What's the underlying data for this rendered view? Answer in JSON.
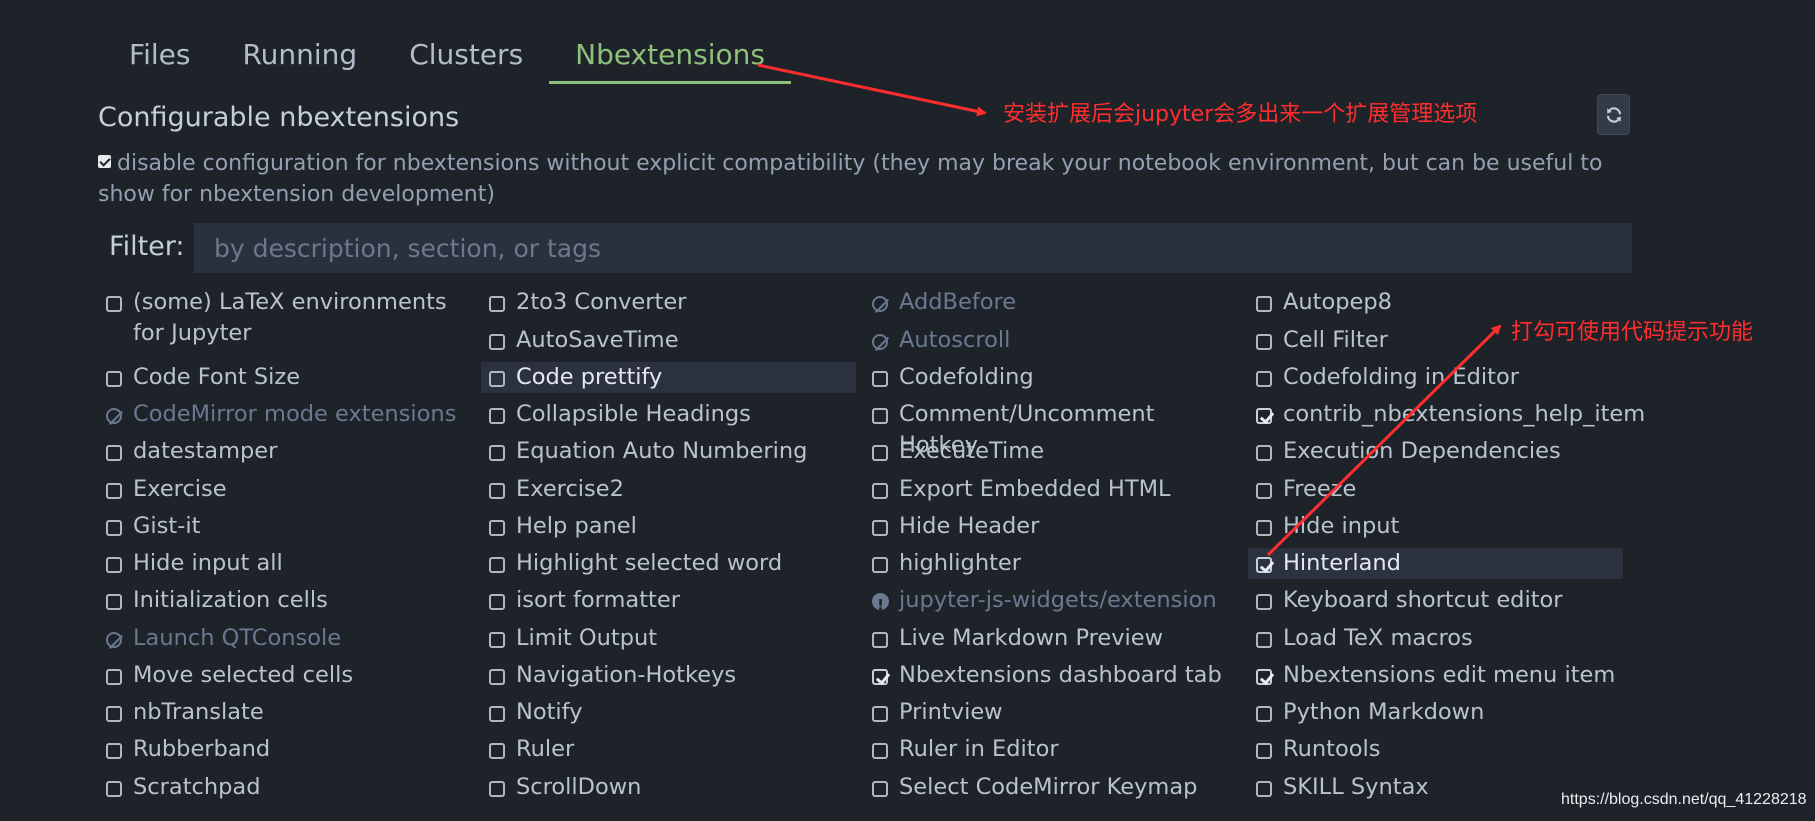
{
  "tabs": [
    {
      "label": "Files"
    },
    {
      "label": "Running"
    },
    {
      "label": "Clusters"
    },
    {
      "label": "Nbextensions",
      "active": true
    }
  ],
  "page_title": "Configurable nbextensions",
  "disable_compat": {
    "checked": true,
    "label": "disable configuration for nbextensions without explicit compatibility (they may break your notebook environment, but can be useful to show for nbextension development)"
  },
  "filter": {
    "label": "Filter:",
    "placeholder": "by description, section, or tags"
  },
  "refresh_icon": "refresh-icon",
  "extensions": [
    [
      {
        "label": "(some) LaTeX environments for Jupyter",
        "state": "unchecked"
      },
      {
        "label": "Code Font Size",
        "state": "unchecked"
      },
      {
        "label": "CodeMirror mode extensions",
        "state": "disabled"
      },
      {
        "label": "datestamper",
        "state": "unchecked"
      },
      {
        "label": "Exercise",
        "state": "unchecked"
      },
      {
        "label": "Gist-it",
        "state": "unchecked"
      },
      {
        "label": "Hide input all",
        "state": "unchecked"
      },
      {
        "label": "Initialization cells",
        "state": "unchecked"
      },
      {
        "label": "Launch QTConsole",
        "state": "disabled"
      },
      {
        "label": "Move selected cells",
        "state": "unchecked"
      },
      {
        "label": "nbTranslate",
        "state": "unchecked"
      },
      {
        "label": "Rubberband",
        "state": "unchecked"
      },
      {
        "label": "Scratchpad",
        "state": "unchecked"
      }
    ],
    [
      {
        "label": "2to3 Converter",
        "state": "unchecked"
      },
      {
        "label": "AutoSaveTime",
        "state": "unchecked"
      },
      {
        "label": "Code prettify",
        "state": "unchecked",
        "highlighted": true
      },
      {
        "label": "Collapsible Headings",
        "state": "unchecked"
      },
      {
        "label": "Equation Auto Numbering",
        "state": "unchecked"
      },
      {
        "label": "Exercise2",
        "state": "unchecked"
      },
      {
        "label": "Help panel",
        "state": "unchecked"
      },
      {
        "label": "Highlight selected word",
        "state": "unchecked"
      },
      {
        "label": "isort formatter",
        "state": "unchecked"
      },
      {
        "label": "Limit Output",
        "state": "unchecked"
      },
      {
        "label": "Navigation-Hotkeys",
        "state": "unchecked"
      },
      {
        "label": "Notify",
        "state": "unchecked"
      },
      {
        "label": "Ruler",
        "state": "unchecked"
      },
      {
        "label": "ScrollDown",
        "state": "unchecked"
      }
    ],
    [
      {
        "label": "AddBefore",
        "state": "disabled"
      },
      {
        "label": "Autoscroll",
        "state": "disabled"
      },
      {
        "label": "Codefolding",
        "state": "unchecked"
      },
      {
        "label": "Comment/Uncomment Hotkey",
        "state": "unchecked"
      },
      {
        "label": "ExecuteTime",
        "state": "unchecked"
      },
      {
        "label": "Export Embedded HTML",
        "state": "unchecked"
      },
      {
        "label": "Hide Header",
        "state": "unchecked"
      },
      {
        "label": "highlighter",
        "state": "unchecked"
      },
      {
        "label": "jupyter-js-widgets/extension",
        "state": "warning"
      },
      {
        "label": "Live Markdown Preview",
        "state": "unchecked"
      },
      {
        "label": "Nbextensions dashboard tab",
        "state": "checked"
      },
      {
        "label": "Printview",
        "state": "unchecked"
      },
      {
        "label": "Ruler in Editor",
        "state": "unchecked"
      },
      {
        "label": "Select CodeMirror Keymap",
        "state": "unchecked"
      }
    ],
    [
      {
        "label": "Autopep8",
        "state": "unchecked"
      },
      {
        "label": "Cell Filter",
        "state": "unchecked"
      },
      {
        "label": "Codefolding in Editor",
        "state": "unchecked"
      },
      {
        "label": "contrib_nbextensions_help_item",
        "state": "checked"
      },
      {
        "label": "Execution Dependencies",
        "state": "unchecked"
      },
      {
        "label": "Freeze",
        "state": "unchecked"
      },
      {
        "label": "Hide input",
        "state": "unchecked"
      },
      {
        "label": "Hinterland",
        "state": "checked",
        "highlighted": true
      },
      {
        "label": "Keyboard shortcut editor",
        "state": "unchecked"
      },
      {
        "label": "Load TeX macros",
        "state": "unchecked"
      },
      {
        "label": "Nbextensions edit menu item",
        "state": "checked"
      },
      {
        "label": "Python Markdown",
        "state": "unchecked"
      },
      {
        "label": "Runtools",
        "state": "unchecked"
      },
      {
        "label": "SKILL Syntax",
        "state": "unchecked"
      }
    ]
  ],
  "annotations": {
    "tab_note": "安装扩展后会jupyter会多出来一个扩展管理选项",
    "hinterland_note": "打勾可使用代码提示功能",
    "color": "#ff2e2e"
  },
  "watermark": "https://blog.csdn.net/qq_41228218"
}
